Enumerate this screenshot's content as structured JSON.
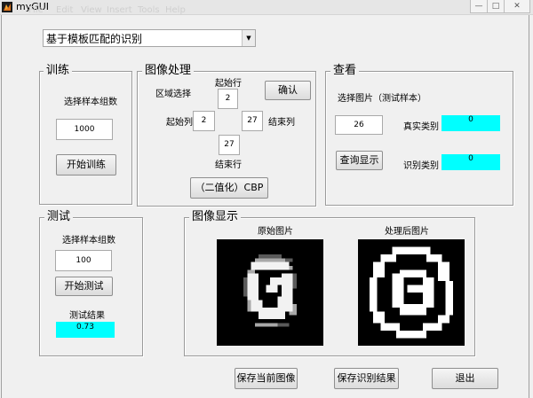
{
  "window": {
    "title": "myGUI",
    "menu": [
      "File",
      "Edit",
      "View",
      "Insert",
      "Tools",
      "Help"
    ],
    "controls": [
      "—",
      "□",
      "✕"
    ]
  },
  "method_select": {
    "selected": "基于模板匹配的识别"
  },
  "train": {
    "title": "训练",
    "sample_label": "选择样本组数",
    "sample_value": "1000",
    "start_button": "开始训练"
  },
  "image_processing": {
    "title": "图像处理",
    "region_label": "区域选择",
    "start_row_label": "起始行",
    "start_row_value": "2",
    "start_col_label": "起始列",
    "start_col_value": "2",
    "end_col_label": "结束列",
    "end_col_value": "27",
    "end_row_label": "结束行",
    "end_row_value": "27",
    "confirm_button": "确认",
    "cbp_button": "（二值化）CBP"
  },
  "view": {
    "title": "查看",
    "select_label": "选择图片（测试样本）",
    "select_value": "26",
    "query_button": "查询显示",
    "true_class_label": "真实类别",
    "true_class_value": "0",
    "recognized_class_label": "识别类别",
    "recognized_class_value": "0",
    "highlight_color": "#00ffff"
  },
  "test": {
    "title": "测试",
    "sample_label": "选择样本组数",
    "sample_value": "100",
    "start_button": "开始测试",
    "result_label": "测试结果",
    "result_value": "0.73"
  },
  "display": {
    "title": "图像显示",
    "original_label": "原始图片",
    "processed_label": "处理后图片"
  },
  "bottom": {
    "save_image_button": "保存当前图像",
    "save_result_button": "保存识别结果",
    "exit_button": "退出"
  }
}
